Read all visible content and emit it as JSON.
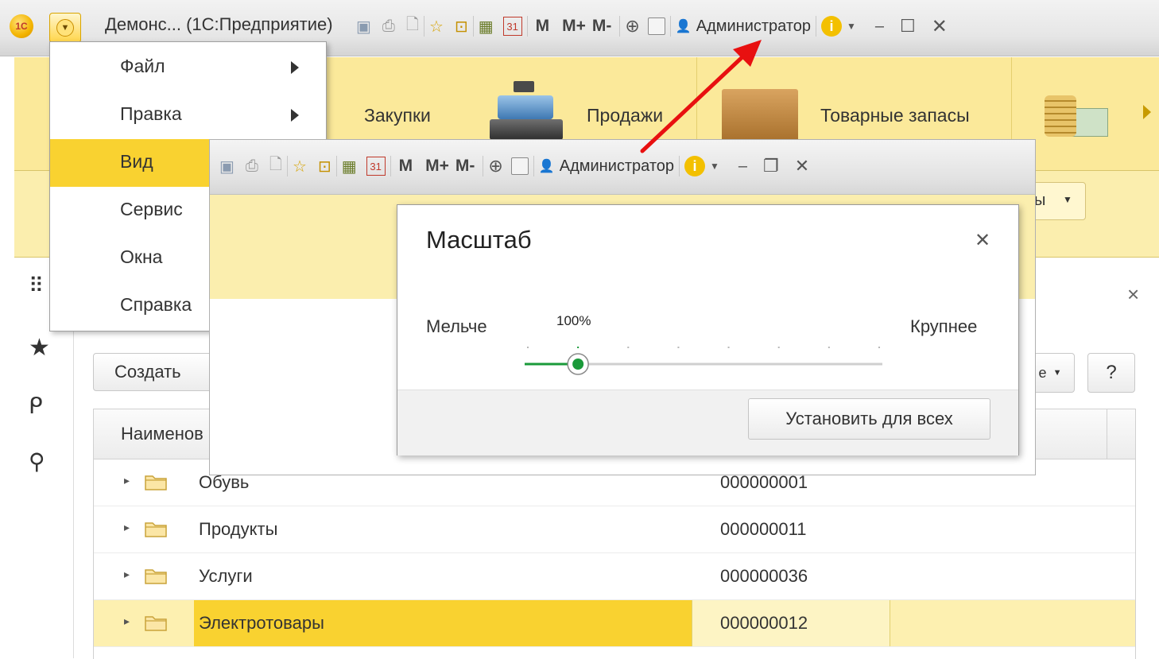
{
  "app": {
    "logo_text": "1С",
    "title": "Демонс... (1С:Предприятие)",
    "user": "Администратор"
  },
  "toolbar": {
    "mem_m": "M",
    "mem_mplus": "M+",
    "mem_mminus": "M-",
    "calendar_day": "31"
  },
  "sections": {
    "items": [
      {
        "label": "Закупки"
      },
      {
        "label": "Продажи"
      },
      {
        "label": "Товарные запасы"
      }
    ],
    "filter_partial": "ы"
  },
  "main_menu": {
    "items": [
      {
        "label": "Файл",
        "submenu": true,
        "active": false
      },
      {
        "label": "Правка",
        "submenu": true,
        "active": false
      },
      {
        "label": "Вид",
        "submenu": false,
        "active": true
      },
      {
        "label": "Сервис",
        "submenu": false,
        "active": false
      },
      {
        "label": "Окна",
        "submenu": false,
        "active": false
      },
      {
        "label": "Справка",
        "submenu": false,
        "active": false
      }
    ]
  },
  "list": {
    "create_label": "Создать",
    "more_partial": "е",
    "help_label": "?",
    "column_name": "Наименов",
    "rows": [
      {
        "name": "Обувь",
        "code": "000000001",
        "selected": false
      },
      {
        "name": "Продукты",
        "code": "000000011",
        "selected": false
      },
      {
        "name": "Услуги",
        "code": "000000036",
        "selected": false
      },
      {
        "name": "Электротовары",
        "code": "000000012",
        "selected": true
      }
    ]
  },
  "scale_dialog": {
    "title": "Масштаб",
    "smaller_label": "Мельче",
    "larger_label": "Крупнее",
    "value_label": "100%",
    "slider_steps": 8,
    "slider_position": 1,
    "set_all_label": "Установить для всех"
  },
  "colors": {
    "accent_yellow": "#f9d230",
    "slider_green": "#1a9a3a",
    "annotation_red": "#e81010"
  }
}
